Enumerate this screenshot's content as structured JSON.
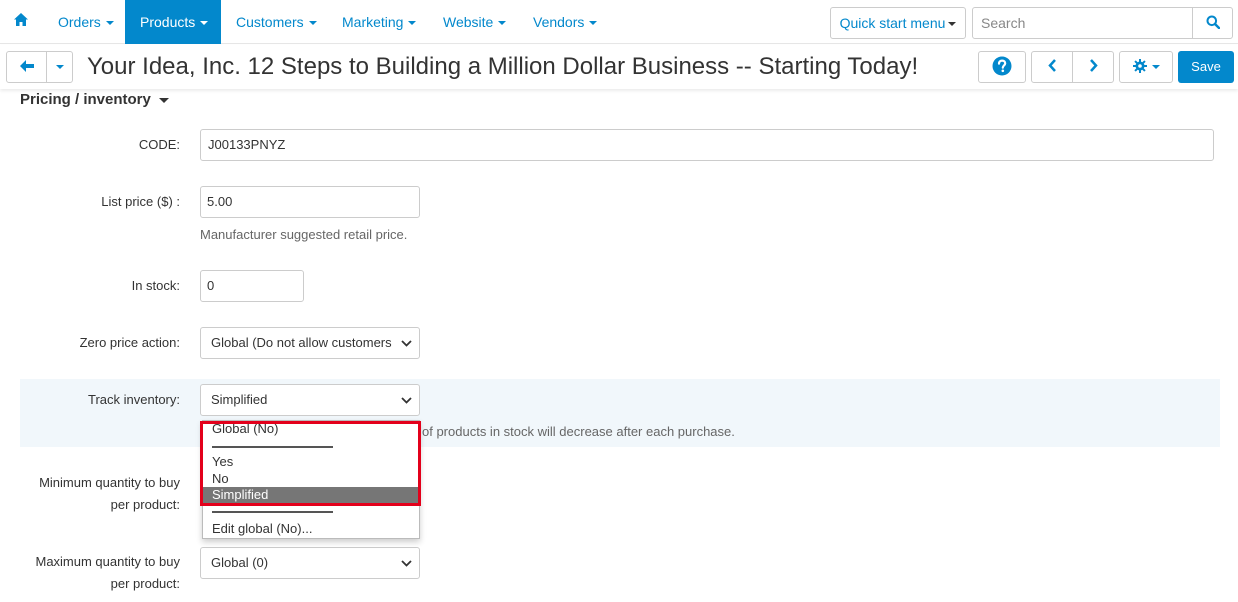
{
  "nav": {
    "items": [
      {
        "label": "Orders"
      },
      {
        "label": "Products"
      },
      {
        "label": "Customers"
      },
      {
        "label": "Marketing"
      },
      {
        "label": "Website"
      },
      {
        "label": "Vendors"
      }
    ],
    "active": "Products",
    "quick_start_label": "Quick start menu",
    "search_placeholder": "Search"
  },
  "toolbar": {
    "title": "Your Idea, Inc. 12 Steps to Building a Million Dollar Business -- Starting Today!",
    "save_label": "Save"
  },
  "section": {
    "title": "Pricing / inventory"
  },
  "form": {
    "code": {
      "label": "CODE:",
      "value": "J00133PNYZ"
    },
    "list_price": {
      "label": "List price ($) :",
      "value": "5.00",
      "help": "Manufacturer suggested retail price."
    },
    "in_stock": {
      "label": "In stock:",
      "value": "0"
    },
    "zero_price_action": {
      "label": "Zero price action:",
      "value": "Global (Do not allow customers"
    },
    "track_inventory": {
      "label": "Track inventory:",
      "value": "Simplified",
      "help_visible": "of products in stock will decrease after each purchase.",
      "options": [
        "Global (No)",
        "Yes",
        "No",
        "Simplified",
        "Edit global (No)..."
      ],
      "selected": "Simplified"
    },
    "min_qty": {
      "label_line1": "Minimum quantity to buy",
      "label_line2": "per product:"
    },
    "max_qty": {
      "label_line1": "Maximum quantity to buy",
      "label_line2": "per product:",
      "value": "Global (0)"
    }
  },
  "colors": {
    "accent": "#0388cc",
    "highlight_row": "#f1f7fb",
    "annotation_red": "#e3001b",
    "selected_option": "#767676"
  },
  "icons": {
    "home": "home-icon",
    "search": "search-icon",
    "back": "arrow-left-icon",
    "help": "question-circle-icon",
    "prev": "chevron-left-icon",
    "next": "chevron-right-icon",
    "settings": "gear-icon"
  }
}
